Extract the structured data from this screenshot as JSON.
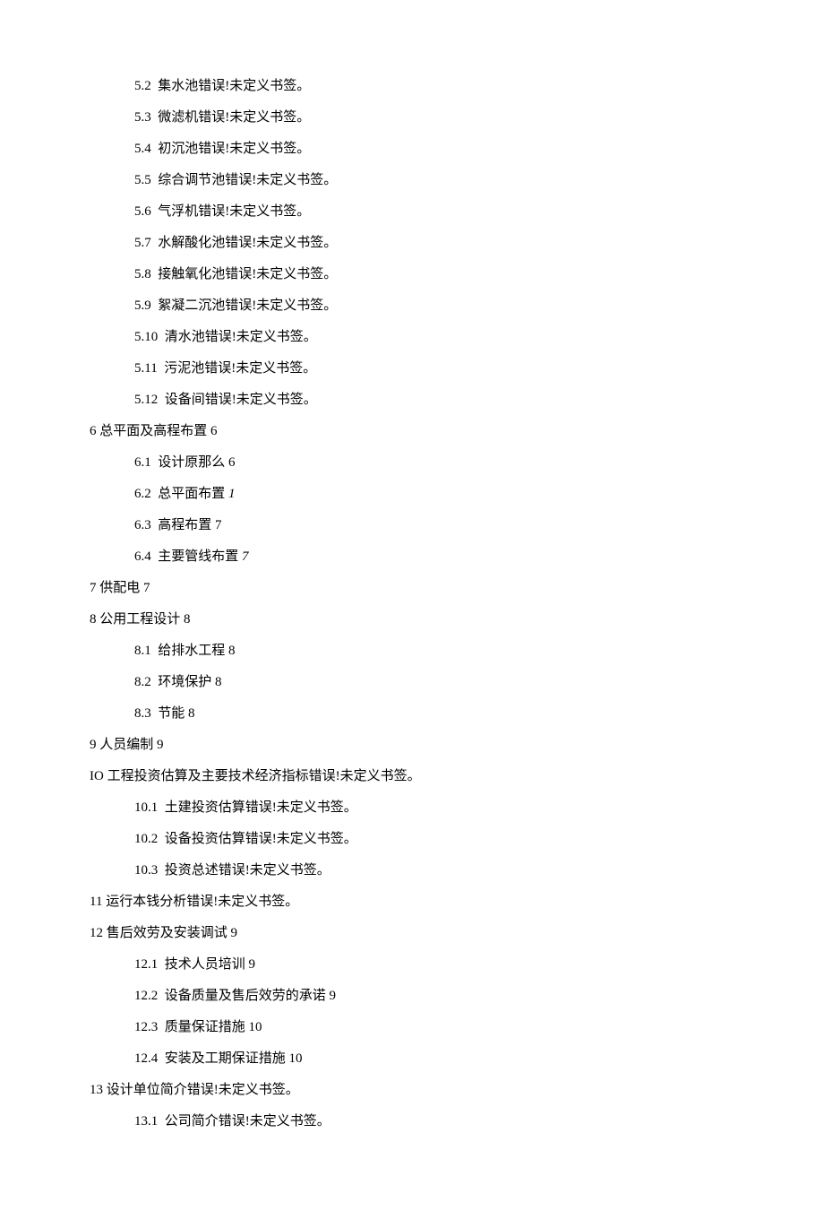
{
  "toc": {
    "sec5": {
      "items": [
        {
          "num": "5.2",
          "text": "集水池错误!未定义书签。"
        },
        {
          "num": "5.3",
          "text": "微滤机错误!未定义书签。"
        },
        {
          "num": "5.4",
          "text": "初沉池错误!未定义书签。"
        },
        {
          "num": "5.5",
          "text": "综合调节池错误!未定义书签。"
        },
        {
          "num": "5.6",
          "text": "气浮机错误!未定义书签。"
        },
        {
          "num": "5.7",
          "text": "水解酸化池错误!未定义书签。"
        },
        {
          "num": "5.8",
          "text": "接触氧化池错误!未定义书签。"
        },
        {
          "num": "5.9",
          "text": "絮凝二沉池错误!未定义书签。"
        },
        {
          "num": "5.10",
          "text": "清水池错误!未定义书签。"
        },
        {
          "num": "5.11",
          "text": "污泥池错误!未定义书签。"
        },
        {
          "num": "5.12",
          "text": "设备间错误!未定义书签。"
        }
      ]
    },
    "sec6": {
      "title": "6 总平面及高程布置 6",
      "items": [
        {
          "num": "6.1",
          "text": "设计原那么 6"
        },
        {
          "num": "6.2",
          "text": "总平面布置",
          "page_italic": "1"
        },
        {
          "num": "6.3",
          "text": "高程布置 7"
        },
        {
          "num": "6.4",
          "text": "主要管线布置",
          "page_italic": "7"
        }
      ]
    },
    "sec7": {
      "title": "7 供配电 7"
    },
    "sec8": {
      "title": "8 公用工程设计 8",
      "items": [
        {
          "num": "8.1",
          "text": "给排水工程 8"
        },
        {
          "num": "8.2",
          "text": "环境保护 8"
        },
        {
          "num": "8.3",
          "text": "节能 8"
        }
      ]
    },
    "sec9": {
      "title": "9 人员编制 9"
    },
    "sec10": {
      "title": "IO 工程投资估算及主要技术经济指标错误!未定义书签。",
      "items": [
        {
          "num": "10.1",
          "text": "土建投资估算错误!未定义书签。"
        },
        {
          "num": "10.2",
          "text": "设备投资估算错误!未定义书签。"
        },
        {
          "num": "10.3",
          "text": "投资总述错误!未定义书签。"
        }
      ]
    },
    "sec11": {
      "title": "11 运行本钱分析错误!未定义书签。"
    },
    "sec12": {
      "title": "12 售后效劳及安装调试 9",
      "items": [
        {
          "num": "12.1",
          "text": "技术人员培训 9"
        },
        {
          "num": "12.2",
          "text": "设备质量及售后效劳的承诺 9"
        },
        {
          "num": "12.3",
          "text": "质量保证措施 10"
        },
        {
          "num": "12.4",
          "text": "安装及工期保证措施 10"
        }
      ]
    },
    "sec13": {
      "title": "13 设计单位简介错误!未定义书签。",
      "items": [
        {
          "num": "13.1",
          "text": "公司简介错误!未定义书签。"
        }
      ]
    }
  }
}
